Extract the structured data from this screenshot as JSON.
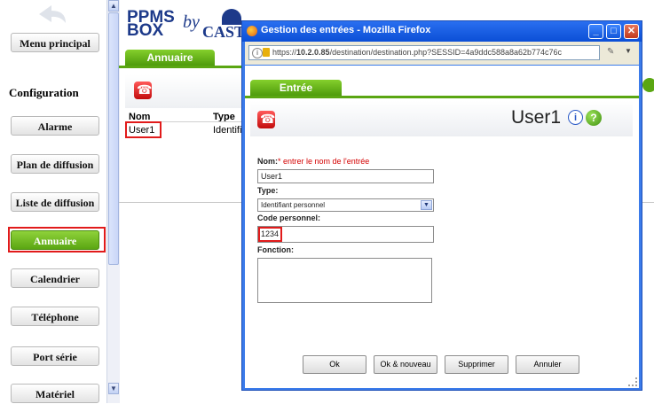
{
  "sidebar": {
    "items": [
      {
        "label": "Menu principal"
      },
      {
        "label": "Alarme"
      },
      {
        "label": "Plan de diffusion"
      },
      {
        "label": "Liste de diffusion"
      },
      {
        "label": "Annuaire"
      },
      {
        "label": "Calendrier"
      },
      {
        "label": "Téléphone"
      },
      {
        "label": "Port série"
      },
      {
        "label": "Matériel"
      }
    ],
    "section_title": "Configuration",
    "active_color": "#5aa612"
  },
  "app": {
    "logo_text_top": "PPMS",
    "logo_text_bottom": "BOX",
    "logo_by": "by",
    "logo_brand_fragment": "CAST",
    "tab_label": "Annuaire",
    "table": {
      "col_nom": "Nom",
      "col_type": "Type",
      "rows": [
        {
          "nom": "User1",
          "type": "Identifi"
        }
      ]
    }
  },
  "popup": {
    "title": "Gestion des entrées - Mozilla Firefox",
    "url_host": "10.2.0.85",
    "url_prefix": "https://",
    "url_path": "/destination/destination.php?SESSID=4a9ddc588a8a62b774c76c",
    "tab_label": "Entrée",
    "heading": "User1",
    "form": {
      "nom_label": "Nom:",
      "nom_required_hint": "* entrer le nom de l'entrée",
      "nom_value": "User1",
      "type_label": "Type:",
      "type_selected": "Identifiant personnel",
      "code_label": "Code personnel:",
      "code_value": "1234",
      "fonction_label": "Fonction:",
      "fonction_value": ""
    },
    "buttons": {
      "ok": "Ok",
      "ok_new": "Ok & nouveau",
      "delete": "Supprimer",
      "cancel": "Annuler"
    },
    "title_bar_color": "#0b4fd6",
    "highlight_color": "#e11b1b"
  }
}
